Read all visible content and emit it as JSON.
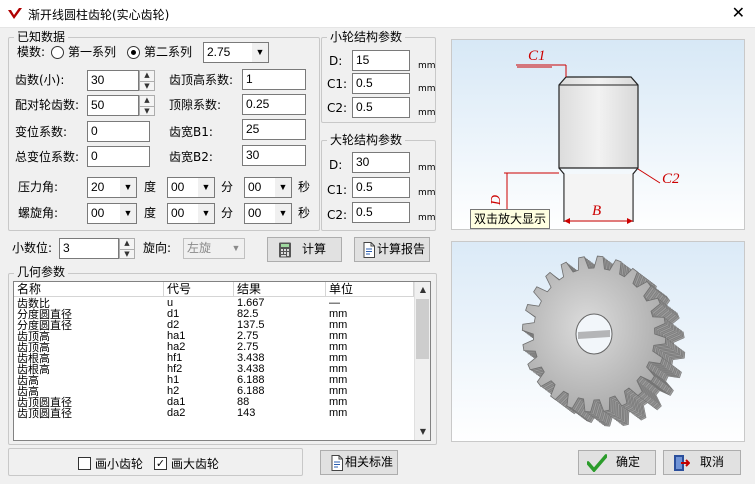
{
  "window": {
    "title": "渐开线圆柱齿轮(实心齿轮)",
    "close_glyph": "✕"
  },
  "known": {
    "group_label": "已知数据",
    "modulus_label": "模数:",
    "series1_label": "第一系列",
    "series2_label": "第二系列",
    "series_selected": "第二系列",
    "modulus_value": "2.75",
    "teeth_small_label": "齿数(小):",
    "teeth_small_value": "30",
    "mating_teeth_label": "配对轮齿数:",
    "mating_teeth_value": "50",
    "shift_label": "变位系数:",
    "shift_value": "0",
    "total_shift_label": "总变位系数:",
    "total_shift_value": "0",
    "addendum_coef_label": "齿顶高系数:",
    "addendum_coef_value": "1",
    "clearance_coef_label": "顶隙系数:",
    "clearance_coef_value": "0.25",
    "width_b1_label": "齿宽B1:",
    "width_b1_value": "25",
    "width_b2_label": "齿宽B2:",
    "width_b2_value": "30",
    "pressure_angle_label": "压力角:",
    "pressure_deg": "20",
    "pressure_min": "00",
    "pressure_sec": "00",
    "helix_angle_label": "螺旋角:",
    "helix_deg": "00",
    "helix_min": "00",
    "helix_sec": "00",
    "unit_deg": "度",
    "unit_min": "分",
    "unit_sec": "秒"
  },
  "small_wheel": {
    "group_label": "小轮结构参数",
    "d_label": "D:",
    "d_value": "15",
    "c1_label": "C1:",
    "c1_value": "0.5",
    "c2_label": "C2:",
    "c2_value": "0.5",
    "unit": "mm"
  },
  "big_wheel": {
    "group_label": "大轮结构参数",
    "d_label": "D:",
    "d_value": "30",
    "c1_label": "C1:",
    "c1_value": "0.5",
    "c2_label": "C2:",
    "c2_value": "0.5",
    "unit": "mm"
  },
  "options": {
    "decimals_label": "小数位:",
    "decimals_value": "3",
    "direction_label": "旋向:",
    "direction_value": "左旋",
    "calc_label": "计算",
    "report_label": "计算报告"
  },
  "geometry": {
    "group_label": "几何参数",
    "columns": [
      "名称",
      "代号",
      "结果",
      "单位"
    ],
    "rows": [
      [
        "齿数比",
        "u",
        "1.667",
        "—"
      ],
      [
        "分度圆直径",
        "d1",
        "82.5",
        "mm"
      ],
      [
        "分度圆直径",
        "d2",
        "137.5",
        "mm"
      ],
      [
        "齿顶高",
        "ha1",
        "2.75",
        "mm"
      ],
      [
        "齿顶高",
        "ha2",
        "2.75",
        "mm"
      ],
      [
        "齿根高",
        "hf1",
        "3.438",
        "mm"
      ],
      [
        "齿根高",
        "hf2",
        "3.438",
        "mm"
      ],
      [
        "齿高",
        "h1",
        "6.188",
        "mm"
      ],
      [
        "齿高",
        "h2",
        "6.188",
        "mm"
      ],
      [
        "齿顶圆直径",
        "da1",
        "88",
        "mm"
      ],
      [
        "齿顶圆直径",
        "da2",
        "143",
        "mm"
      ]
    ]
  },
  "draw_options": {
    "small_gear_label": "画小齿轮",
    "small_gear_checked": false,
    "big_gear_label": "画大齿轮",
    "big_gear_checked": true
  },
  "footer": {
    "standard_label": "相关标准",
    "ok_label": "确定",
    "cancel_label": "取消"
  },
  "preview": {
    "tooltip": "双击放大显示",
    "labels": {
      "c1": "C1",
      "c2": "C2",
      "d": "D",
      "b": "B"
    },
    "colors": {
      "dim_red": "#cc0000",
      "body_gray": "#e6e6e6",
      "sky_top": "#dbeaf7"
    }
  }
}
